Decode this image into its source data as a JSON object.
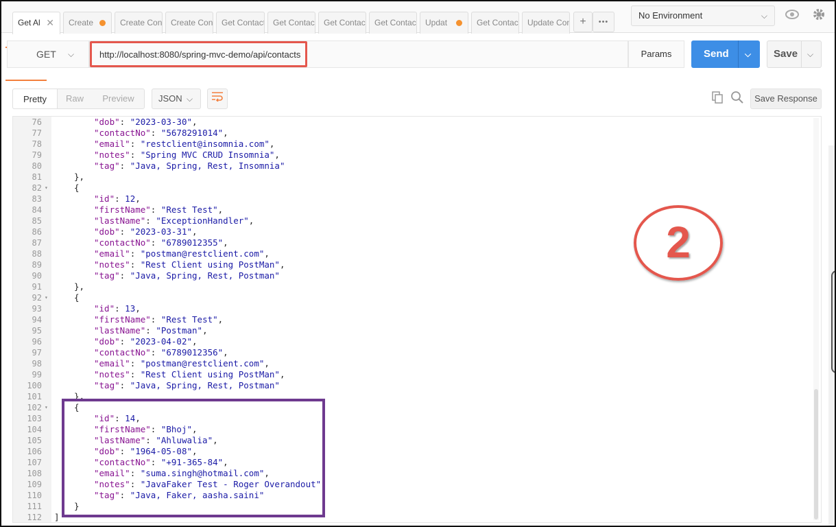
{
  "tabs": [
    {
      "label": "Get Al",
      "active": true,
      "marker": "close"
    },
    {
      "label": "Create",
      "active": false,
      "marker": "dot"
    },
    {
      "label": "Create Cont",
      "active": false,
      "marker": ""
    },
    {
      "label": "Create Cont",
      "active": false,
      "marker": ""
    },
    {
      "label": "Get Contact",
      "active": false,
      "marker": ""
    },
    {
      "label": "Get Contact",
      "active": false,
      "marker": ""
    },
    {
      "label": "Get Contact",
      "active": false,
      "marker": ""
    },
    {
      "label": "Get Contact",
      "active": false,
      "marker": ""
    },
    {
      "label": "Updat",
      "active": false,
      "marker": "dot"
    },
    {
      "label": "Get Contact",
      "active": false,
      "marker": ""
    },
    {
      "label": "Update Con",
      "active": false,
      "marker": ""
    }
  ],
  "tab_actions": {
    "add": "+",
    "more": "•••"
  },
  "environment": {
    "selected": "No Environment"
  },
  "request": {
    "method": "GET",
    "url": "http://localhost:8080/spring-mvc-demo/api/contacts",
    "params_label": "Params",
    "send_label": "Send",
    "save_label": "Save"
  },
  "response_toolbar": {
    "views": [
      "Pretty",
      "Raw",
      "Preview"
    ],
    "active_view": "Pretty",
    "format": "JSON",
    "save_response_label": "Save Response"
  },
  "icons": {
    "close": "close-icon",
    "eye": "eye-icon",
    "settings": "gear-icon",
    "wrap": "wrap-lines-icon",
    "copy": "copy-icon",
    "search": "search-icon"
  },
  "colors": {
    "accent_orange": "#f37f3d",
    "send_blue": "#3d8ee6",
    "highlight_red": "#e4574d",
    "highlight_purple": "#6e3a8f",
    "json_key": "#881391",
    "json_value": "#1a1aa6"
  },
  "code_lines": [
    {
      "n": "76",
      "fold": false,
      "indent": 2,
      "key": "dob",
      "val": "\"2023-03-30\"",
      "vtype": "s",
      "comma": true
    },
    {
      "n": "77",
      "fold": false,
      "indent": 2,
      "key": "contactNo",
      "val": "\"5678291014\"",
      "vtype": "s",
      "comma": true
    },
    {
      "n": "78",
      "fold": false,
      "indent": 2,
      "key": "email",
      "val": "\"restclient@insomnia.com\"",
      "vtype": "s",
      "comma": true
    },
    {
      "n": "79",
      "fold": false,
      "indent": 2,
      "key": "notes",
      "val": "\"Spring MVC CRUD Insomnia\"",
      "vtype": "s",
      "comma": true
    },
    {
      "n": "80",
      "fold": false,
      "indent": 2,
      "key": "tag",
      "val": "\"Java, Spring, Rest, Insomnia\"",
      "vtype": "s",
      "comma": false
    },
    {
      "n": "81",
      "fold": false,
      "indent": 1,
      "raw": "},"
    },
    {
      "n": "82",
      "fold": true,
      "indent": 1,
      "raw": "{"
    },
    {
      "n": "83",
      "fold": false,
      "indent": 2,
      "key": "id",
      "val": "12",
      "vtype": "n",
      "comma": true
    },
    {
      "n": "84",
      "fold": false,
      "indent": 2,
      "key": "firstName",
      "val": "\"Rest Test\"",
      "vtype": "s",
      "comma": true
    },
    {
      "n": "85",
      "fold": false,
      "indent": 2,
      "key": "lastName",
      "val": "\"ExceptionHandler\"",
      "vtype": "s",
      "comma": true
    },
    {
      "n": "86",
      "fold": false,
      "indent": 2,
      "key": "dob",
      "val": "\"2023-03-31\"",
      "vtype": "s",
      "comma": true
    },
    {
      "n": "87",
      "fold": false,
      "indent": 2,
      "key": "contactNo",
      "val": "\"6789012355\"",
      "vtype": "s",
      "comma": true
    },
    {
      "n": "88",
      "fold": false,
      "indent": 2,
      "key": "email",
      "val": "\"postman@restclient.com\"",
      "vtype": "s",
      "comma": true
    },
    {
      "n": "89",
      "fold": false,
      "indent": 2,
      "key": "notes",
      "val": "\"Rest Client using PostMan\"",
      "vtype": "s",
      "comma": true
    },
    {
      "n": "90",
      "fold": false,
      "indent": 2,
      "key": "tag",
      "val": "\"Java, Spring, Rest, Postman\"",
      "vtype": "s",
      "comma": false
    },
    {
      "n": "91",
      "fold": false,
      "indent": 1,
      "raw": "},"
    },
    {
      "n": "92",
      "fold": true,
      "indent": 1,
      "raw": "{"
    },
    {
      "n": "93",
      "fold": false,
      "indent": 2,
      "key": "id",
      "val": "13",
      "vtype": "n",
      "comma": true
    },
    {
      "n": "94",
      "fold": false,
      "indent": 2,
      "key": "firstName",
      "val": "\"Rest Test\"",
      "vtype": "s",
      "comma": true
    },
    {
      "n": "95",
      "fold": false,
      "indent": 2,
      "key": "lastName",
      "val": "\"Postman\"",
      "vtype": "s",
      "comma": true
    },
    {
      "n": "96",
      "fold": false,
      "indent": 2,
      "key": "dob",
      "val": "\"2023-04-02\"",
      "vtype": "s",
      "comma": true
    },
    {
      "n": "97",
      "fold": false,
      "indent": 2,
      "key": "contactNo",
      "val": "\"6789012356\"",
      "vtype": "s",
      "comma": true
    },
    {
      "n": "98",
      "fold": false,
      "indent": 2,
      "key": "email",
      "val": "\"postman@restclient.com\"",
      "vtype": "s",
      "comma": true
    },
    {
      "n": "99",
      "fold": false,
      "indent": 2,
      "key": "notes",
      "val": "\"Rest Client using PostMan\"",
      "vtype": "s",
      "comma": true
    },
    {
      "n": "100",
      "fold": false,
      "indent": 2,
      "key": "tag",
      "val": "\"Java, Spring, Rest, Postman\"",
      "vtype": "s",
      "comma": false
    },
    {
      "n": "101",
      "fold": false,
      "indent": 1,
      "raw": "},"
    },
    {
      "n": "102",
      "fold": true,
      "indent": 1,
      "raw": "{"
    },
    {
      "n": "103",
      "fold": false,
      "indent": 2,
      "key": "id",
      "val": "14",
      "vtype": "n",
      "comma": true
    },
    {
      "n": "104",
      "fold": false,
      "indent": 2,
      "key": "firstName",
      "val": "\"Bhoj\"",
      "vtype": "s",
      "comma": true
    },
    {
      "n": "105",
      "fold": false,
      "indent": 2,
      "key": "lastName",
      "val": "\"Ahluwalia\"",
      "vtype": "s",
      "comma": true
    },
    {
      "n": "106",
      "fold": false,
      "indent": 2,
      "key": "dob",
      "val": "\"1964-05-08\"",
      "vtype": "s",
      "comma": true
    },
    {
      "n": "107",
      "fold": false,
      "indent": 2,
      "key": "contactNo",
      "val": "\"+91-365-84\"",
      "vtype": "s",
      "comma": true
    },
    {
      "n": "108",
      "fold": false,
      "indent": 2,
      "key": "email",
      "val": "\"suma.singh@hotmail.com\"",
      "vtype": "s",
      "comma": true
    },
    {
      "n": "109",
      "fold": false,
      "indent": 2,
      "key": "notes",
      "val": "\"JavaFaker Test - Roger Overandout\"",
      "vtype": "s",
      "comma": true
    },
    {
      "n": "110",
      "fold": false,
      "indent": 2,
      "key": "tag",
      "val": "\"Java, Faker, aasha.saini\"",
      "vtype": "s",
      "comma": false
    },
    {
      "n": "111",
      "fold": false,
      "indent": 1,
      "raw": "}"
    },
    {
      "n": "112",
      "fold": false,
      "indent": 0,
      "raw": "]"
    }
  ],
  "annotation": {
    "step_number": "2"
  }
}
